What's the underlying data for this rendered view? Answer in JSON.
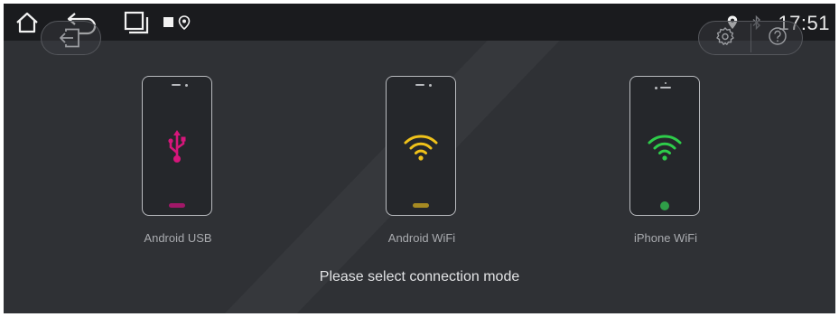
{
  "status_bar": {
    "time": "17:51",
    "icons": [
      "home-icon",
      "back-icon",
      "recent-apps-icon",
      "notification-square-icon",
      "maps-pin-icon",
      "location-icon",
      "bluetooth-icon"
    ]
  },
  "toolbar": {
    "left_button_icon": "exit-icon",
    "right_buttons": [
      "settings-icon",
      "help-icon"
    ]
  },
  "connection_modes": [
    {
      "label": "Android USB",
      "icon": "usb-icon",
      "accent": "#d6167b",
      "indicator": "bar"
    },
    {
      "label": "Android WiFi",
      "icon": "wifi-icon",
      "accent": "#f0c21a",
      "indicator": "bar"
    },
    {
      "label": "iPhone WiFi",
      "icon": "wifi-icon",
      "accent": "#2ecc4a",
      "indicator": "dot"
    }
  ],
  "prompt": "Please select connection mode",
  "colors": {
    "background": "#2f3135",
    "status_bar": "#1a1b1e",
    "usb_accent": "#d6167b",
    "android_wifi_accent": "#f0c21a",
    "iphone_wifi_accent": "#2ecc4a",
    "home_bar_usb": "#a11868",
    "home_bar_wifi": "#a68a22",
    "home_dot_iphone": "#2f9e48"
  }
}
